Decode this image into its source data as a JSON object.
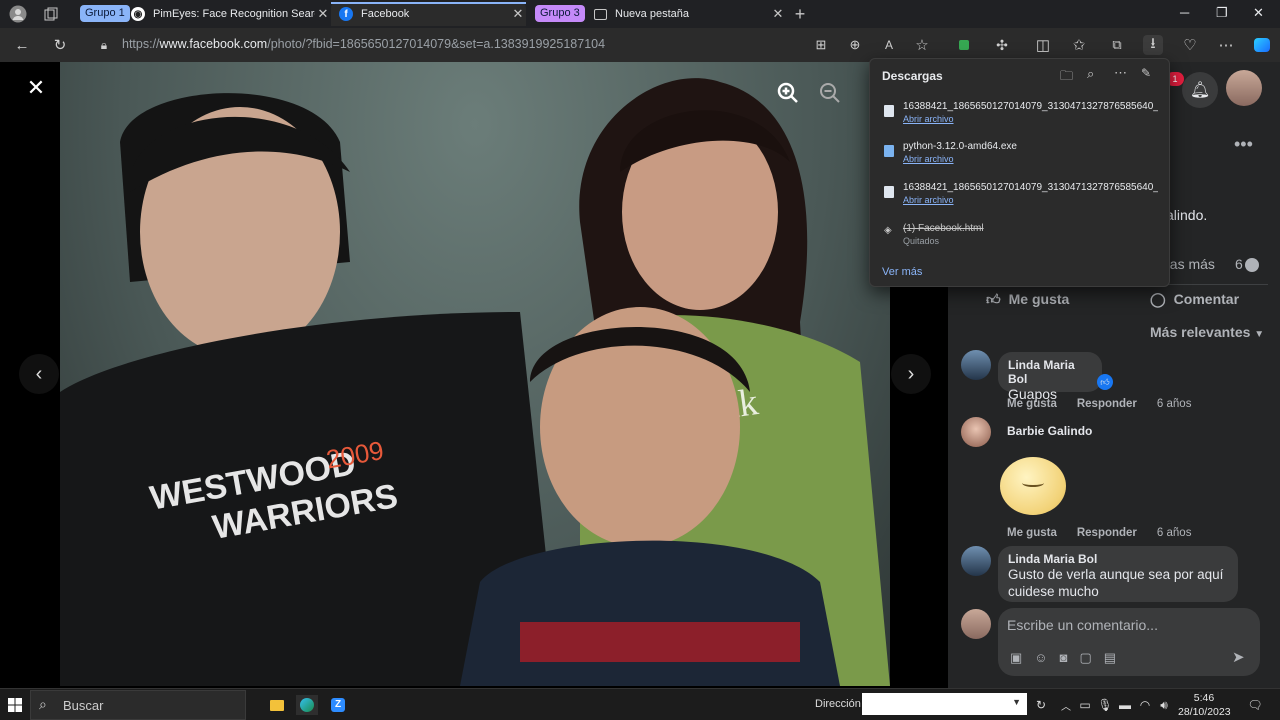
{
  "tabs": {
    "group1": "Grupo 1",
    "group3": "Grupo 3",
    "items": [
      {
        "title": "PimEyes: Face Recognition Search"
      },
      {
        "title": "Facebook"
      },
      {
        "title": "Nueva pestaña"
      }
    ]
  },
  "address": {
    "scheme": "https://",
    "host": "www.facebook.com",
    "path": "/photo/?fbid=1865650127014079&set=a.1383919925187104"
  },
  "downloads": {
    "title": "Descargas",
    "items": [
      {
        "name": "16388421_1865650127014079_3130471327876585640_...",
        "action": "Abrir archivo"
      },
      {
        "name": "python-3.12.0-amd64.exe",
        "action": "Abrir archivo"
      },
      {
        "name": "16388421_1865650127014079_3130471327876585640_...",
        "action": "Abrir archivo"
      },
      {
        "name": "(1) Facebook.html",
        "action": "Quitados"
      }
    ],
    "see_more": "Ver más"
  },
  "panel": {
    "notif_badge": "1",
    "caption_tail": "alindo.",
    "more_text": "nas más",
    "comment_count": "6",
    "like_label": "Me gusta",
    "comment_label": "Comentar",
    "sort_label": "Más relevantes",
    "comments": [
      {
        "author": "Linda Maria Bol",
        "text": "Guapos",
        "like": "Me gusta",
        "reply": "Responder",
        "age": "6 años"
      },
      {
        "author": "Barbie Galindo",
        "text": "",
        "like": "Me gusta",
        "reply": "Responder",
        "age": "6 años"
      },
      {
        "author": "Linda Maria Bol",
        "text": "Gusto de verla aunque sea por aquí cuidese mucho"
      }
    ],
    "composer_placeholder": "Escribe un comentario..."
  },
  "photo": {
    "shirt_line1": "WESTWOOD",
    "shirt_line2": "WARRIORS",
    "shirt_year": "2009",
    "girl_shirt": "Osiak"
  },
  "taskbar": {
    "search": "Buscar",
    "address_label": "Dirección",
    "time": "5:46",
    "date": "28/10/2023"
  },
  "colors": {
    "accent": "#1877f2",
    "group1": "#8ab4f8",
    "group3": "#c58af9",
    "panel": "#242526"
  }
}
